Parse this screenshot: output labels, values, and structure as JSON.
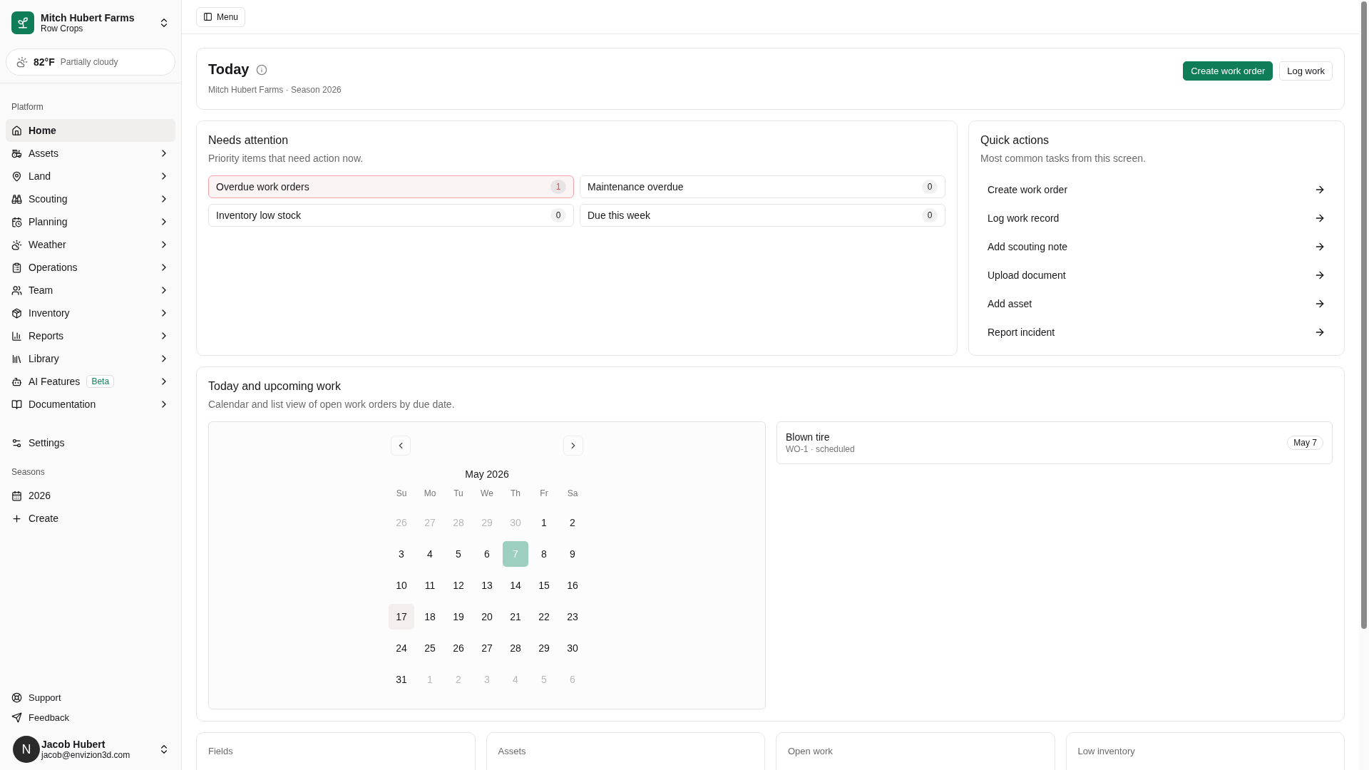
{
  "farm": {
    "name": "Mitch Hubert Farms",
    "subtitle": "Row Crops"
  },
  "weather": {
    "temp": "82°F",
    "condition": "Partially cloudy"
  },
  "sidebar": {
    "sections": [
      {
        "title": "Platform",
        "items": [
          {
            "label": "Home",
            "selected": true,
            "expandable": false
          },
          {
            "label": "Assets",
            "selected": false,
            "expandable": true
          },
          {
            "label": "Land",
            "selected": false,
            "expandable": true
          },
          {
            "label": "Scouting",
            "selected": false,
            "expandable": true
          },
          {
            "label": "Planning",
            "selected": false,
            "expandable": true
          },
          {
            "label": "Weather",
            "selected": false,
            "expandable": true
          },
          {
            "label": "Operations",
            "selected": false,
            "expandable": true
          },
          {
            "label": "Team",
            "selected": false,
            "expandable": true
          },
          {
            "label": "Inventory",
            "selected": false,
            "expandable": true
          },
          {
            "label": "Reports",
            "selected": false,
            "expandable": true
          },
          {
            "label": "Library",
            "selected": false,
            "expandable": true
          },
          {
            "label": "AI Features",
            "badge": "Beta",
            "selected": false,
            "expandable": true
          },
          {
            "label": "Documentation",
            "selected": false,
            "expandable": true
          }
        ]
      },
      {
        "items": [
          {
            "label": "Settings",
            "selected": false,
            "expandable": false
          }
        ]
      },
      {
        "title": "Seasons",
        "items": [
          {
            "label": "2026",
            "selected": false,
            "expandable": false
          },
          {
            "label": "Create",
            "selected": false,
            "expandable": false
          }
        ]
      }
    ],
    "footer_links": [
      "Support",
      "Feedback"
    ],
    "user": {
      "initial": "N",
      "name": "Jacob Hubert",
      "email": "jacob@envizion3d.com"
    }
  },
  "topbar": {
    "menu_button": "Menu"
  },
  "header": {
    "title": "Today",
    "subtitle": "Mitch Hubert Farms · Season 2026",
    "buttons": [
      {
        "label": "Create work order",
        "kind": "primary"
      },
      {
        "label": "Log work",
        "kind": "outline"
      }
    ]
  },
  "needs_attention": {
    "title": "Needs attention",
    "description": "Priority items that need action now.",
    "items": [
      {
        "label": "Overdue work orders",
        "count": "1",
        "alert": true
      },
      {
        "label": "Maintenance overdue",
        "count": "0",
        "alert": false
      },
      {
        "label": "Inventory low stock",
        "count": "0",
        "alert": false
      },
      {
        "label": "Due this week",
        "count": "0",
        "alert": false
      }
    ]
  },
  "quick_actions": {
    "title": "Quick actions",
    "description": "Most common tasks from this screen.",
    "items": [
      "Create work order",
      "Log work record",
      "Add scouting note",
      "Upload document",
      "Add asset",
      "Report incident"
    ]
  },
  "upcoming": {
    "title": "Today and upcoming work",
    "description": "Calendar and list view of open work orders by due date.",
    "calendar": {
      "month": "May 2026",
      "weekdays": [
        "Su",
        "Mo",
        "Tu",
        "We",
        "Th",
        "Fr",
        "Sa"
      ],
      "weeks": [
        [
          {
            "d": "26",
            "outside": true,
            "selected": false,
            "today": false
          },
          {
            "d": "27",
            "outside": true,
            "selected": false,
            "today": false
          },
          {
            "d": "28",
            "outside": true,
            "selected": false,
            "today": false
          },
          {
            "d": "29",
            "outside": true,
            "selected": false,
            "today": false
          },
          {
            "d": "30",
            "outside": true,
            "selected": false,
            "today": false
          },
          {
            "d": "1",
            "outside": false,
            "selected": false,
            "today": false
          },
          {
            "d": "2",
            "outside": false,
            "selected": false,
            "today": false
          }
        ],
        [
          {
            "d": "3",
            "outside": false,
            "selected": false,
            "today": false
          },
          {
            "d": "4",
            "outside": false,
            "selected": false,
            "today": false
          },
          {
            "d": "5",
            "outside": false,
            "selected": false,
            "today": false
          },
          {
            "d": "6",
            "outside": false,
            "selected": false,
            "today": false
          },
          {
            "d": "7",
            "outside": false,
            "selected": true,
            "today": false
          },
          {
            "d": "8",
            "outside": false,
            "selected": false,
            "today": false
          },
          {
            "d": "9",
            "outside": false,
            "selected": false,
            "today": false
          }
        ],
        [
          {
            "d": "10",
            "outside": false,
            "selected": false,
            "today": false
          },
          {
            "d": "11",
            "outside": false,
            "selected": false,
            "today": false
          },
          {
            "d": "12",
            "outside": false,
            "selected": false,
            "today": false
          },
          {
            "d": "13",
            "outside": false,
            "selected": false,
            "today": false
          },
          {
            "d": "14",
            "outside": false,
            "selected": false,
            "today": false
          },
          {
            "d": "15",
            "outside": false,
            "selected": false,
            "today": false
          },
          {
            "d": "16",
            "outside": false,
            "selected": false,
            "today": false
          }
        ],
        [
          {
            "d": "17",
            "outside": false,
            "selected": false,
            "today": true
          },
          {
            "d": "18",
            "outside": false,
            "selected": false,
            "today": false
          },
          {
            "d": "19",
            "outside": false,
            "selected": false,
            "today": false
          },
          {
            "d": "20",
            "outside": false,
            "selected": false,
            "today": false
          },
          {
            "d": "21",
            "outside": false,
            "selected": false,
            "today": false
          },
          {
            "d": "22",
            "outside": false,
            "selected": false,
            "today": false
          },
          {
            "d": "23",
            "outside": false,
            "selected": false,
            "today": false
          }
        ],
        [
          {
            "d": "24",
            "outside": false,
            "selected": false,
            "today": false
          },
          {
            "d": "25",
            "outside": false,
            "selected": false,
            "today": false
          },
          {
            "d": "26",
            "outside": false,
            "selected": false,
            "today": false
          },
          {
            "d": "27",
            "outside": false,
            "selected": false,
            "today": false
          },
          {
            "d": "28",
            "outside": false,
            "selected": false,
            "today": false
          },
          {
            "d": "29",
            "outside": false,
            "selected": false,
            "today": false
          },
          {
            "d": "30",
            "outside": false,
            "selected": false,
            "today": false
          }
        ],
        [
          {
            "d": "31",
            "outside": false,
            "selected": false,
            "today": false
          },
          {
            "d": "1",
            "outside": true,
            "selected": false,
            "today": false
          },
          {
            "d": "2",
            "outside": true,
            "selected": false,
            "today": false
          },
          {
            "d": "3",
            "outside": true,
            "selected": false,
            "today": false
          },
          {
            "d": "4",
            "outside": true,
            "selected": false,
            "today": false
          },
          {
            "d": "5",
            "outside": true,
            "selected": false,
            "today": false
          },
          {
            "d": "6",
            "outside": true,
            "selected": false,
            "today": false
          }
        ]
      ]
    },
    "work_orders": [
      {
        "title": "Blown tire",
        "meta": "WO-1 · scheduled",
        "date": "May 7"
      }
    ]
  },
  "stats": [
    {
      "label": "Fields"
    },
    {
      "label": "Assets"
    },
    {
      "label": "Open work"
    },
    {
      "label": "Low inventory"
    }
  ]
}
